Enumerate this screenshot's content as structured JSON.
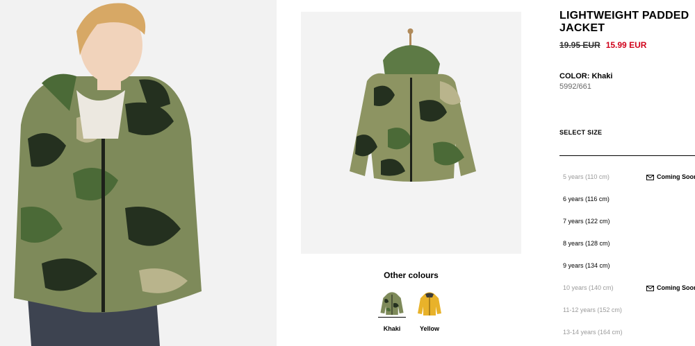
{
  "product": {
    "title_line1": "LIGHTWEIGHT PADDED",
    "title_line2": "JACKET",
    "old_price": "19.95 EUR",
    "new_price": "15.99 EUR",
    "color_label": "COLOR: Khaki",
    "reference": "5992/661"
  },
  "images": {
    "model_photo": "boy-wearing-camo-jacket-photo",
    "product_photo": "camo-jacket-on-hanger-photo"
  },
  "other_colours": {
    "title": "Other colours",
    "swatches": [
      {
        "label": "Khaki",
        "icon": "camo-jacket-thumbnail",
        "selected": true
      },
      {
        "label": "Yellow",
        "icon": "yellow-jacket-thumbnail",
        "selected": false
      }
    ]
  },
  "size_selector": {
    "title": "SELECT SIZE",
    "sizes": [
      {
        "label": "5 years (110 cm)",
        "available": false,
        "note": "Coming Soon"
      },
      {
        "label": "6 years (116 cm)",
        "available": true,
        "note": ""
      },
      {
        "label": "7 years (122 cm)",
        "available": true,
        "note": ""
      },
      {
        "label": "8 years (128 cm)",
        "available": true,
        "note": ""
      },
      {
        "label": "9 years (134 cm)",
        "available": true,
        "note": ""
      },
      {
        "label": "10 years (140 cm)",
        "available": false,
        "note": "Coming Soon"
      },
      {
        "label": "11-12 years (152 cm)",
        "available": false,
        "note": ""
      },
      {
        "label": "13-14 years (164 cm)",
        "available": false,
        "note": ""
      }
    ]
  },
  "colors": {
    "sale_price": "#d0021b",
    "unavailable_text": "#9a9a9a",
    "camo_dark": "#24301f",
    "camo_green": "#5d7a45",
    "camo_light": "#b9b48c",
    "yellow_jacket": "#e8b22a"
  }
}
